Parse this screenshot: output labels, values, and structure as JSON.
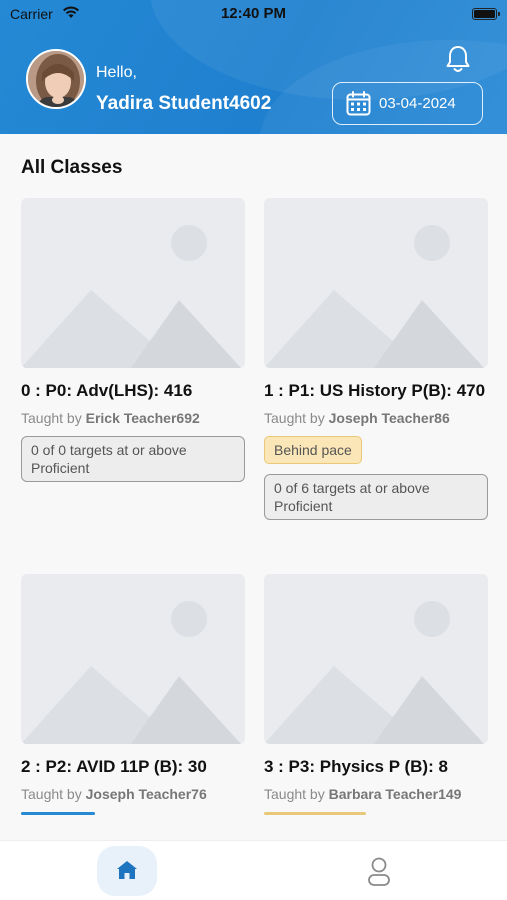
{
  "status_bar": {
    "carrier": "Carrier",
    "time": "12:40 PM"
  },
  "header": {
    "greeting": "Hello,",
    "user_name": "Yadira Student4602",
    "date": "03-04-2024",
    "accent_color": "#2589d4"
  },
  "main": {
    "section_title": "All Classes",
    "classes": [
      {
        "name": "0 : P0: Adv(LHS): 416",
        "taught_by_prefix": "Taught by",
        "teacher": "Erick Teacher692",
        "targets": "0 of 0 targets at or above Proficient"
      },
      {
        "name": "1 : P1: US History P(B): 470",
        "taught_by_prefix": "Taught by",
        "teacher": "Joseph Teacher86",
        "badge": "Behind pace",
        "targets": "0 of 6 targets at or above Proficient"
      },
      {
        "name": "2 : P2: AVID 11P (B): 30",
        "taught_by_prefix": "Taught by",
        "teacher": "Joseph Teacher76",
        "bar_color": "#2589d4"
      },
      {
        "name": "3 : P3: Physics P (B): 8",
        "taught_by_prefix": "Taught by",
        "teacher": "Barbara Teacher149",
        "bar_color": "#e9c879"
      }
    ]
  },
  "tabs": [
    {
      "icon": "home-icon",
      "active": true
    },
    {
      "icon": "profile-icon",
      "active": false
    }
  ]
}
